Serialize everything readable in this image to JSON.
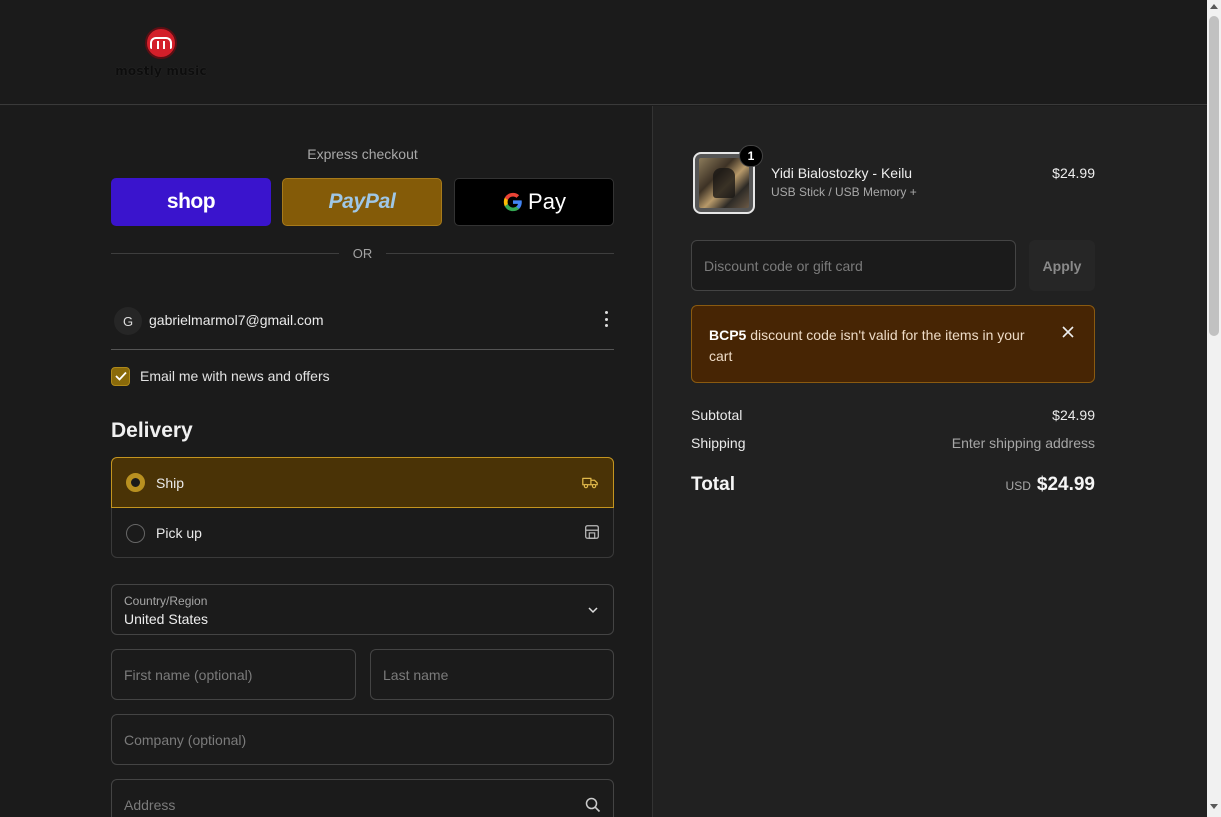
{
  "brand": {
    "name": "mostly music"
  },
  "express": {
    "title": "Express checkout",
    "shop_label": "shop",
    "paypal_label": "PayPal",
    "gpay_g": "G",
    "gpay_label": "Pay",
    "or_label": "OR"
  },
  "account": {
    "avatar_initial": "G",
    "email": "gabrielmarmol7@gmail.com"
  },
  "newsletter": {
    "label": "Email me with news and offers",
    "checked": true
  },
  "delivery": {
    "title": "Delivery",
    "options": [
      {
        "label": "Ship",
        "selected": true,
        "icon": "truck-icon"
      },
      {
        "label": "Pick up",
        "selected": false,
        "icon": "store-icon"
      }
    ]
  },
  "form": {
    "country_label": "Country/Region",
    "country_value": "United States",
    "first_name_placeholder": "First name (optional)",
    "last_name_placeholder": "Last name",
    "company_placeholder": "Company (optional)",
    "address_placeholder": "Address"
  },
  "cart": {
    "item": {
      "name": "Yidi Bialostozky - Keilu",
      "variant": "USB Stick / USB Memory +",
      "price": "$24.99",
      "quantity": "1"
    },
    "discount_placeholder": "Discount code or gift card",
    "apply_label": "Apply",
    "alert": {
      "code": "BCP5",
      "message": " discount code isn't valid for the items in your cart"
    },
    "subtotal_label": "Subtotal",
    "subtotal_value": "$24.99",
    "shipping_label": "Shipping",
    "shipping_value": "Enter shipping address",
    "total_label": "Total",
    "total_currency": "USD",
    "total_value": "$24.99"
  },
  "colors": {
    "accent": "#b89020",
    "shop_bg": "#3a14cd",
    "paypal_bg": "#845b08",
    "alert_bg": "#472504"
  }
}
